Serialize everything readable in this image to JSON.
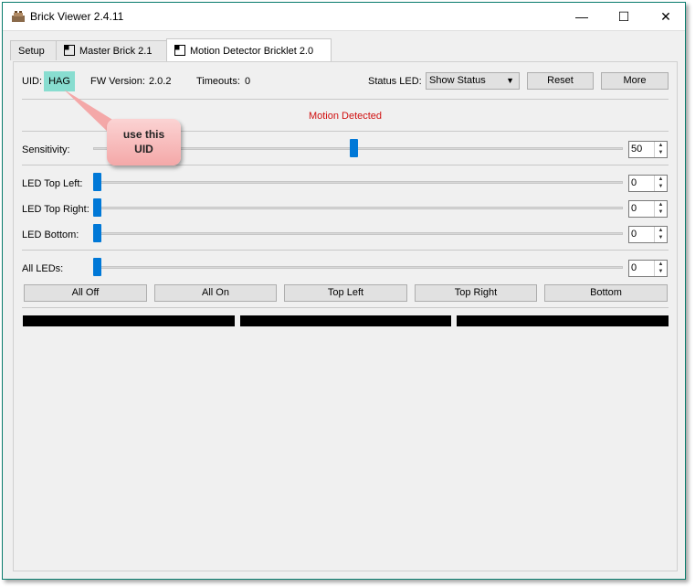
{
  "window": {
    "title": "Brick Viewer 2.4.11"
  },
  "tabs": [
    {
      "label": "Setup",
      "active": false
    },
    {
      "label": "Master Brick 2.1",
      "active": false
    },
    {
      "label": "Motion Detector Bricklet 2.0",
      "active": true
    }
  ],
  "header": {
    "uid_label": "UID:",
    "uid_value": "HAG",
    "fw_label": "FW Version:",
    "fw_value": "2.0.2",
    "timeouts_label": "Timeouts:",
    "timeouts_value": "0",
    "status_led_label": "Status LED:",
    "status_led_value": "Show Status",
    "reset_label": "Reset",
    "more_label": "More"
  },
  "status": {
    "text": "Motion Detected",
    "color": "#d01010"
  },
  "sensitivity": {
    "label": "Sensitivity:",
    "value": "50",
    "level": 50,
    "max": 100
  },
  "leds": [
    {
      "label": "LED Top Left:",
      "value": "0",
      "level": 0
    },
    {
      "label": "LED Top Right:",
      "value": "0",
      "level": 0
    },
    {
      "label": "LED Bottom:",
      "value": "0",
      "level": 0
    }
  ],
  "all_leds": {
    "label": "All LEDs:",
    "value": "0",
    "level": 0
  },
  "buttons": [
    "All Off",
    "All On",
    "Top Left",
    "Top Right",
    "Bottom"
  ],
  "callout": {
    "line1": "use this",
    "line2": "UID"
  },
  "colors": {
    "accent": "#0078d7",
    "uid_highlight": "#88ddd0",
    "callout": "#f4a8a8"
  }
}
